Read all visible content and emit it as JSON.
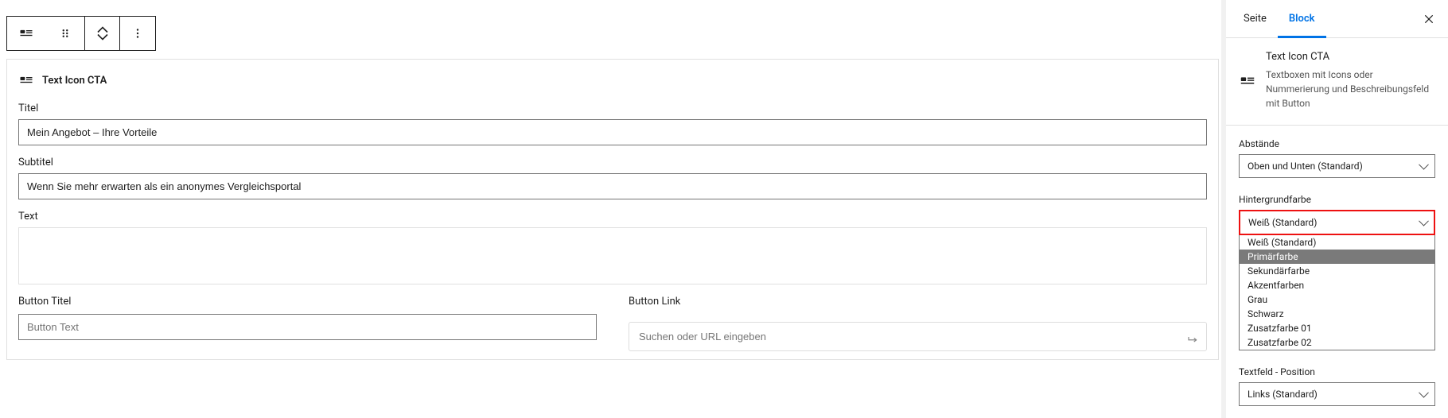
{
  "editor": {
    "block_title": "Text Icon CTA",
    "fields": {
      "titel_label": "Titel",
      "titel_value": "Mein Angebot – Ihre Vorteile",
      "subtitel_label": "Subtitel",
      "subtitel_value": "Wenn Sie mehr erwarten als ein anonymes Vergleichsportal",
      "text_label": "Text",
      "text_value": "",
      "button_titel_label": "Button Titel",
      "button_titel_placeholder": "Button Text",
      "button_titel_value": "",
      "button_link_label": "Button Link",
      "button_link_placeholder": "Suchen oder URL eingeben",
      "button_link_value": ""
    }
  },
  "sidebar": {
    "tabs": {
      "page": "Seite",
      "block": "Block"
    },
    "block_name": "Text Icon CTA",
    "block_desc": "Textboxen mit Icons oder Nummerierung und Beschreibungsfeld mit Button",
    "abstaende_label": "Abstände",
    "abstaende_value": "Oben und Unten (Standard)",
    "hintergrund_label": "Hintergrundfarbe",
    "hintergrund_value": "Weiß (Standard)",
    "hintergrund_options": [
      "Weiß (Standard)",
      "Primärfarbe",
      "Sekundärfarbe",
      "Akzentfarben",
      "Grau",
      "Schwarz",
      "Zusatzfarbe 01",
      "Zusatzfarbe 02"
    ],
    "hintergrund_hover_index": 1,
    "textfeld_label": "Textfeld - Position",
    "textfeld_value": "Links (Standard)"
  }
}
